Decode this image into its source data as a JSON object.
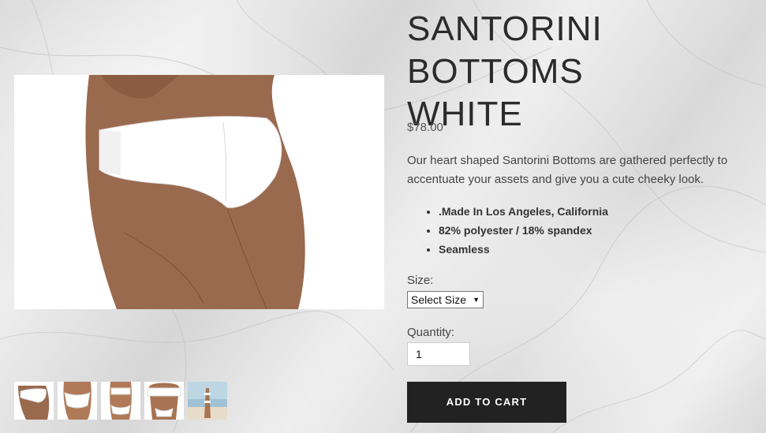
{
  "product": {
    "title_line1": "SANTORINI BOTTOMS",
    "title_line2": "WHITE",
    "price": "$78.00",
    "description": "Our heart shaped Santorini Bottoms are gathered perfectly to accentuate your assets and give you a cute cheeky look.",
    "features": [
      ".Made In Los Angeles, California",
      "82% polyester / 18% spandex",
      "Seamless"
    ]
  },
  "form": {
    "size_label": "Size:",
    "size_selected": "Select Size",
    "quantity_label": "Quantity:",
    "quantity_value": "1",
    "add_to_cart_label": "ADD TO CART"
  },
  "colors": {
    "button_bg": "#222222",
    "text": "#333333"
  }
}
